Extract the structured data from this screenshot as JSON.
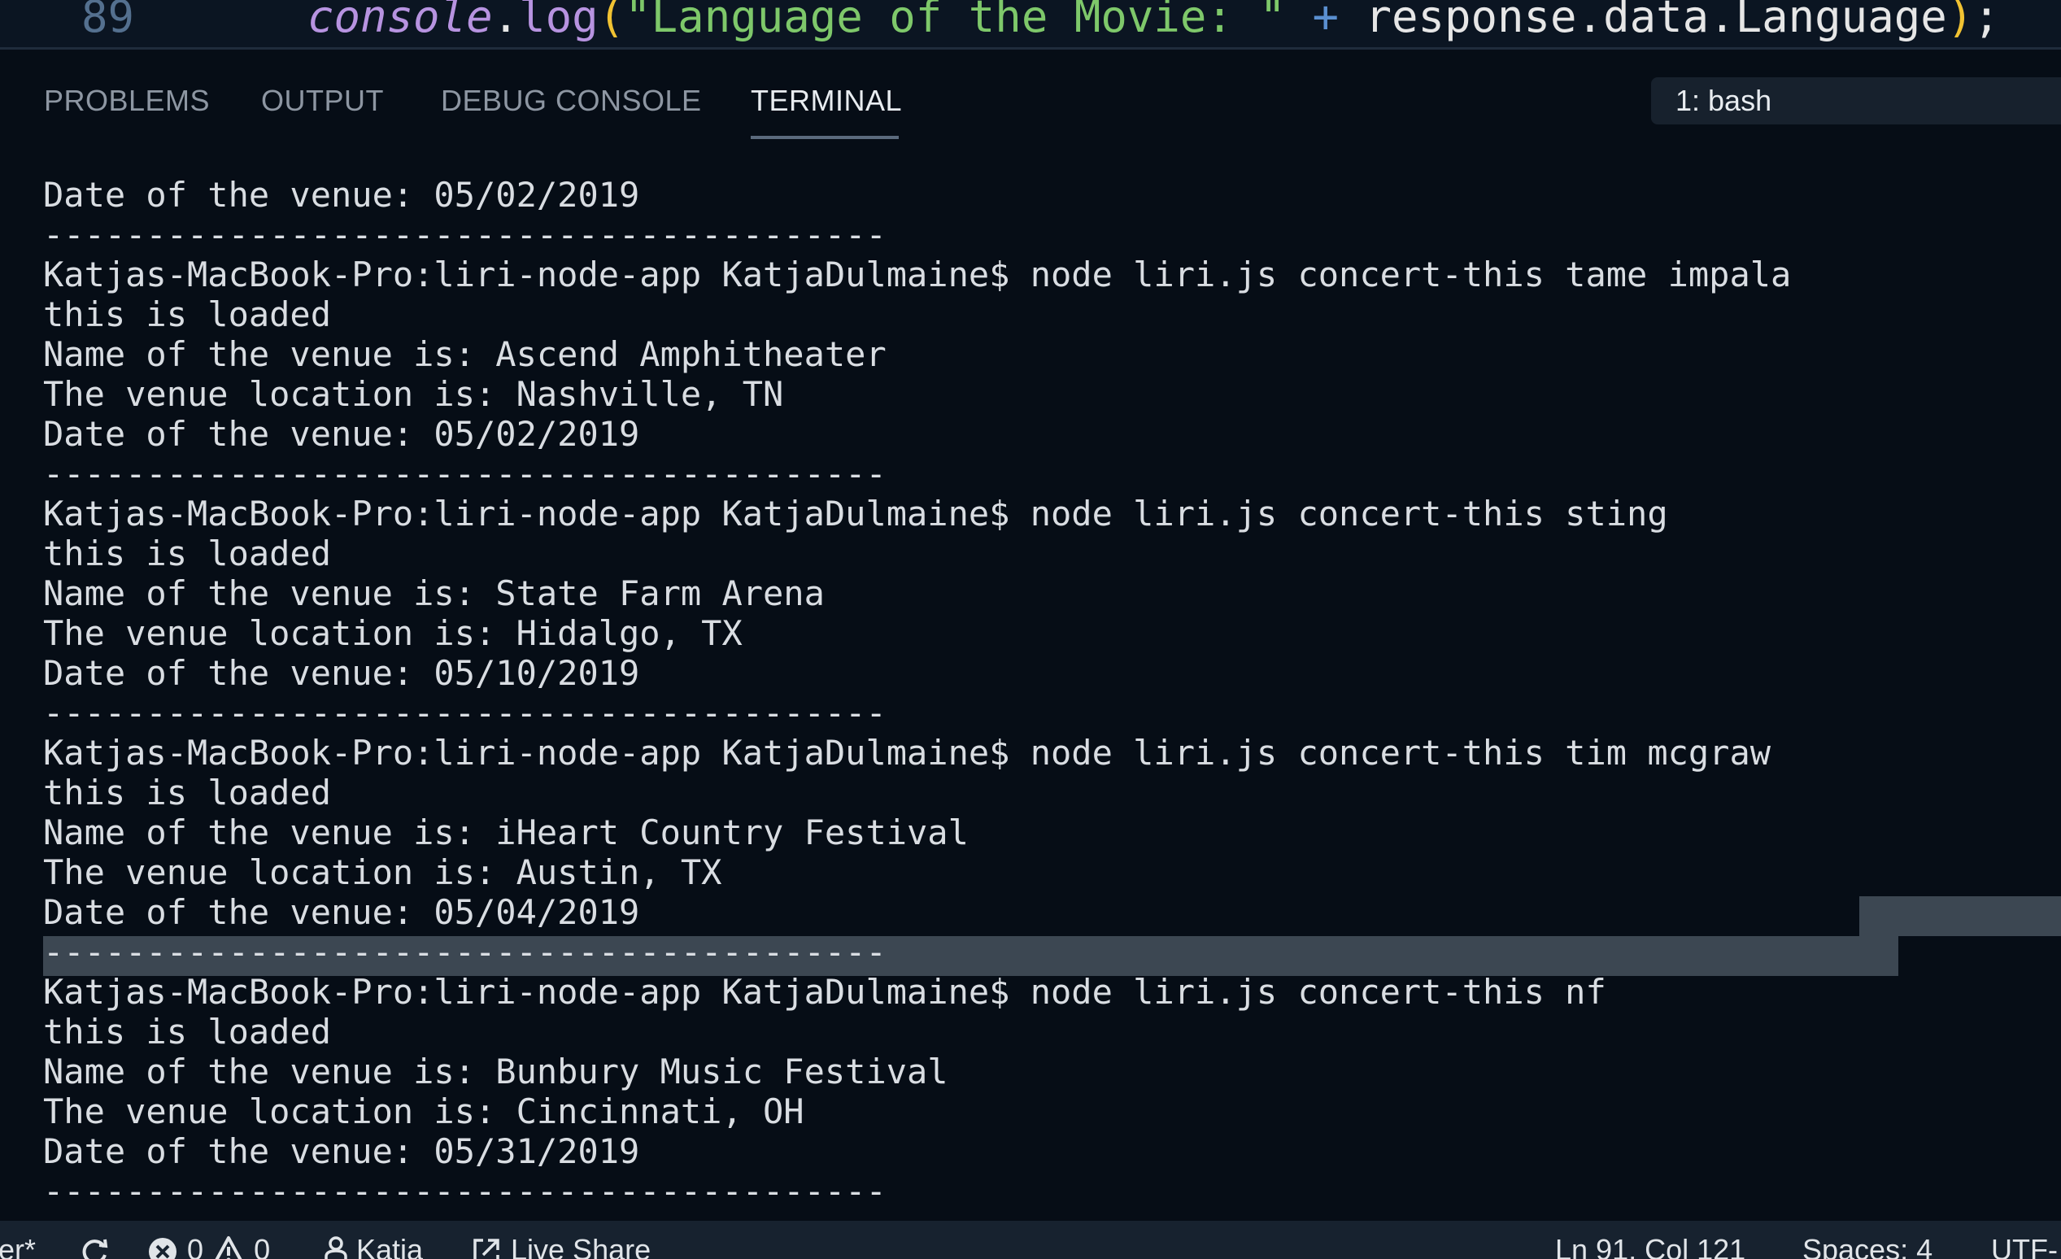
{
  "editor": {
    "line_number": "89",
    "code_object": "console",
    "code_dot1": ".",
    "code_fn": "log",
    "code_paren_open": "(",
    "code_string": "\"Language of the Movie: \"",
    "code_plus": " + ",
    "code_expr": "response.data.Language",
    "code_paren_close": ")",
    "code_semicolon": ";"
  },
  "panel": {
    "tabs": [
      {
        "label": "PROBLEMS",
        "active": false
      },
      {
        "label": "OUTPUT",
        "active": false
      },
      {
        "label": "DEBUG CONSOLE",
        "active": false
      },
      {
        "label": "TERMINAL",
        "active": true
      }
    ],
    "terminal_selector": "1: bash"
  },
  "terminal": {
    "lines": [
      "Date of the venue: 05/02/2019",
      "-----------------------------------------",
      "Katjas-MacBook-Pro:liri-node-app KatjaDulmaine$ node liri.js concert-this tame impala",
      "this is loaded",
      "Name of the venue is: Ascend Amphitheater",
      "The venue location is: Nashville, TN",
      "Date of the venue: 05/02/2019",
      "-----------------------------------------",
      "Katjas-MacBook-Pro:liri-node-app KatjaDulmaine$ node liri.js concert-this sting",
      "this is loaded",
      "Name of the venue is: State Farm Arena",
      "The venue location is: Hidalgo, TX",
      "Date of the venue: 05/10/2019",
      "-----------------------------------------",
      "Katjas-MacBook-Pro:liri-node-app KatjaDulmaine$ node liri.js concert-this tim mcgraw",
      "this is loaded",
      "Name of the venue is: iHeart Country Festival",
      "The venue location is: Austin, TX",
      "Date of the venue: 05/04/2019",
      "-----------------------------------------",
      "Katjas-MacBook-Pro:liri-node-app KatjaDulmaine$ node liri.js concert-this nf",
      "this is loaded",
      "Name of the venue is: Bunbury Music Festival",
      "The venue location is: Cincinnati, OH",
      "Date of the venue: 05/31/2019",
      "-----------------------------------------"
    ]
  },
  "status_bar": {
    "branch_fragment": "er*",
    "errors": "0",
    "warnings": "0",
    "user": "Katja",
    "live_share": "Live Share",
    "position": "Ln 91, Col 121",
    "spaces": "Spaces: 4",
    "encoding": "UTF-"
  },
  "colors": {
    "background": "#060d16",
    "status_bar": "#17222f",
    "selection": "#3c4752",
    "string": "#7ec86a",
    "keyword_object": "#b793e0"
  },
  "icons": {
    "sync": "sync-icon",
    "error": "error-icon",
    "warning": "warning-icon",
    "person": "person-icon",
    "live_share": "live-share-icon"
  }
}
